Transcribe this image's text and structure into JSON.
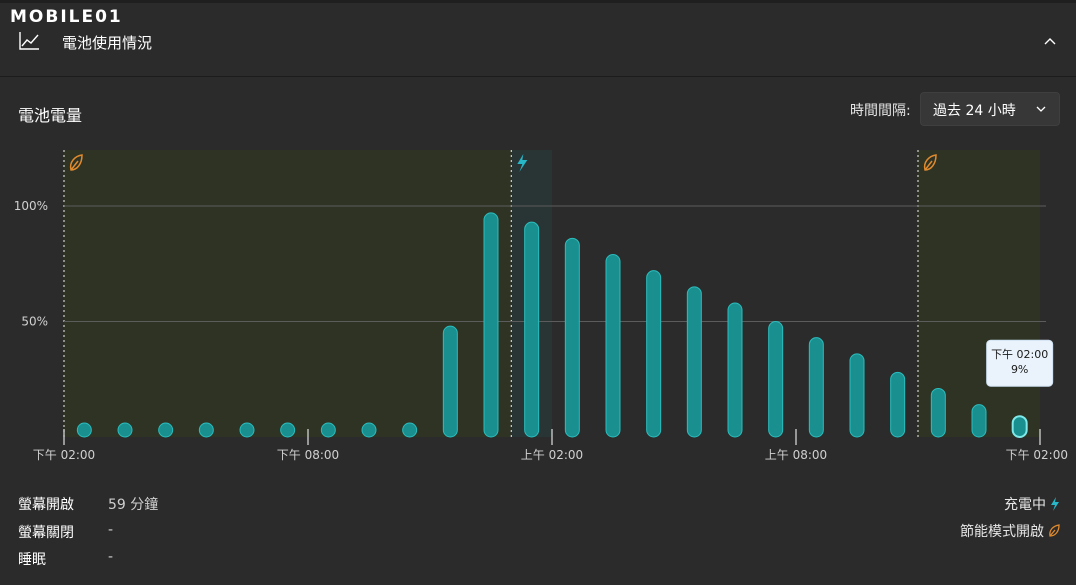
{
  "watermark": {
    "text": "MOBILE01"
  },
  "header": {
    "title": "電池使用情況",
    "icon": "line-chart-icon",
    "collapse_icon": "chevron-up-icon"
  },
  "battery": {
    "title": "電池電量",
    "interval_label": "時間間隔:",
    "interval_value": "過去 24 小時",
    "interval_icon": "chevron-down-icon"
  },
  "chart_data": {
    "type": "bar",
    "title": "",
    "ylabel": "",
    "xlabel": "",
    "ylim": [
      0,
      100
    ],
    "y_ticks": [
      "100%",
      "50%"
    ],
    "y_tick_values": [
      100,
      50
    ],
    "x_tick_labels": [
      "下午 02:00",
      "下午 08:00",
      "上午 02:00",
      "上午 08:00",
      "下午 02:00"
    ],
    "x_tick_hours": [
      0,
      6,
      12,
      18,
      24
    ],
    "bar_hours": [
      0.5,
      1.5,
      2.5,
      3.5,
      4.5,
      5.5,
      6.5,
      7.5,
      8.5,
      9.5,
      10.5,
      11.5,
      12.5,
      13.5,
      14.5,
      15.5,
      16.5,
      17.5,
      18.5,
      19.5,
      20.5,
      21.5,
      22.5,
      23.5
    ],
    "values": [
      3,
      3,
      3,
      3,
      3,
      3,
      3,
      3,
      3,
      48,
      97,
      93,
      86,
      79,
      72,
      65,
      58,
      50,
      43,
      36,
      28,
      21,
      14,
      9
    ],
    "regions": [
      {
        "type": "saver",
        "start_hour": 0,
        "end_hour": 11,
        "icon": "leaf-icon"
      },
      {
        "type": "charging",
        "start_hour": 11,
        "end_hour": 12,
        "icon": "lightning-icon"
      },
      {
        "type": "saver",
        "start_hour": 21,
        "end_hour": 24,
        "icon": "leaf-icon"
      }
    ],
    "tooltip": {
      "time": "下午 02:00",
      "value": "9%"
    },
    "colors": {
      "bar": "#1a8f90",
      "bar_stroke": "#2bbdbd",
      "saver_region": "#2e3324",
      "charging_region": "#293535",
      "leaf": "#e08a2e",
      "lightning": "#27b7c7",
      "grid": "#5c5c5c"
    }
  },
  "stats": [
    {
      "label": "螢幕開啟",
      "value": "59 分鐘"
    },
    {
      "label": "螢幕關閉",
      "value": "-"
    },
    {
      "label": "睡眠",
      "value": "-"
    }
  ],
  "legend": [
    {
      "label": "充電中",
      "icon": "lightning-icon"
    },
    {
      "label": "節能模式開啟",
      "icon": "leaf-icon"
    }
  ]
}
